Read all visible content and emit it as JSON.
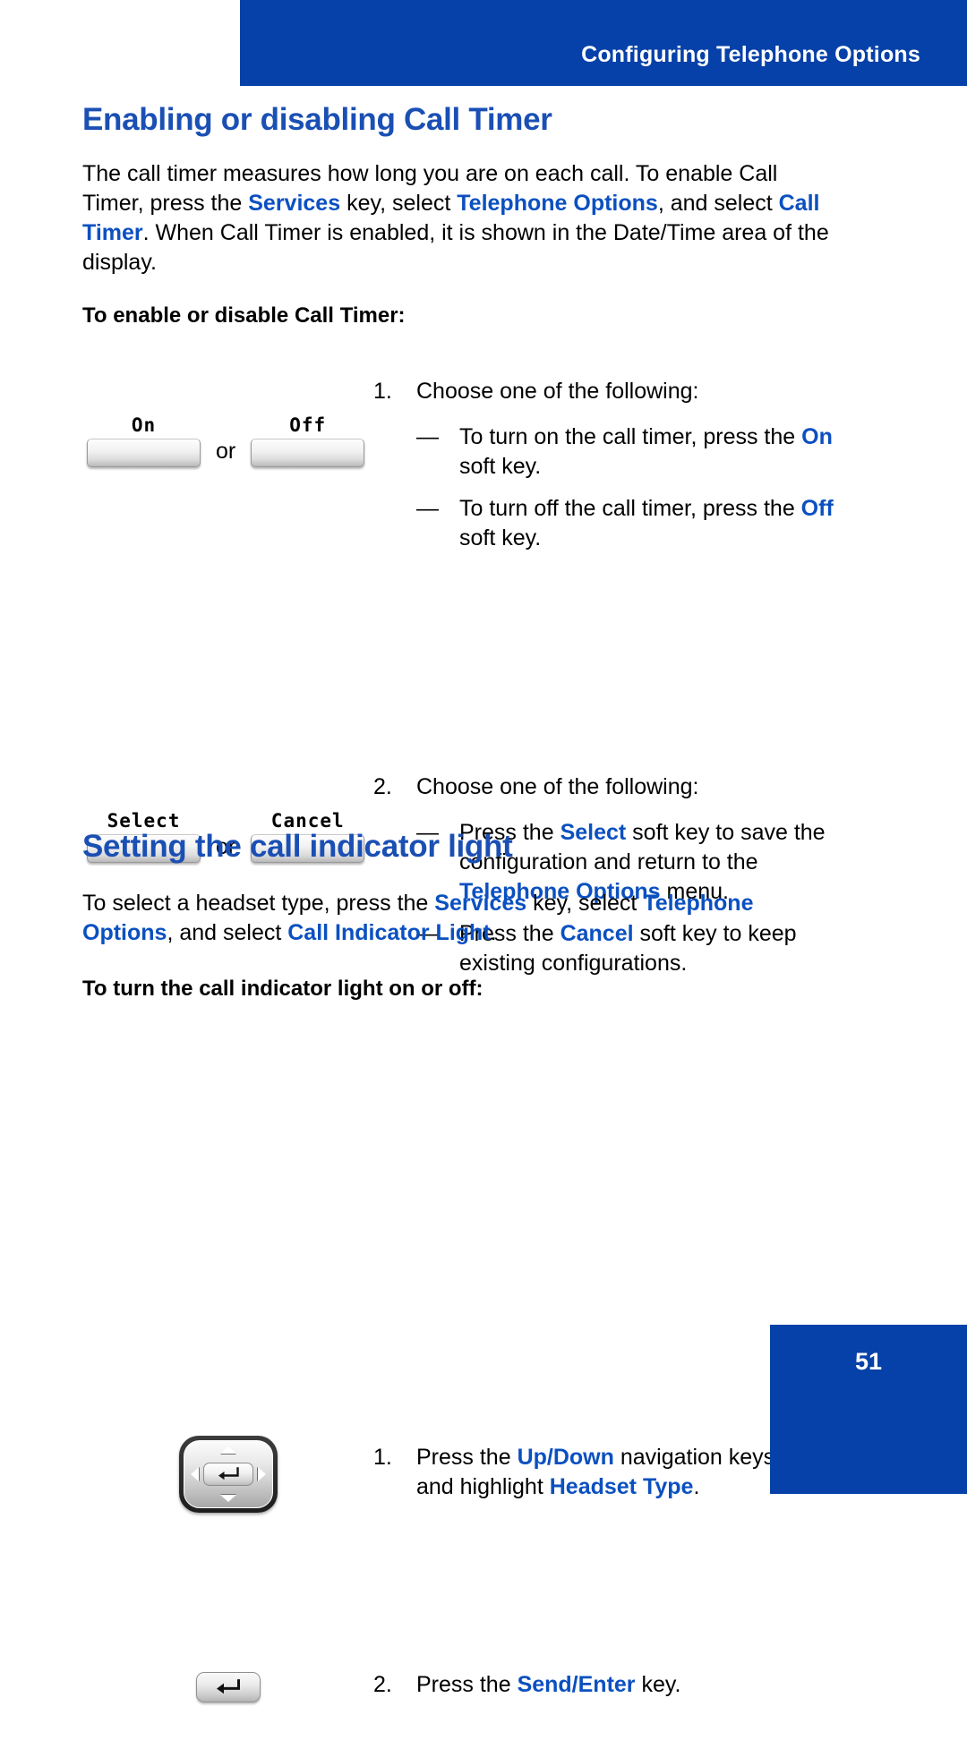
{
  "header": {
    "title": "Configuring Telephone Options",
    "banner_color": "#0541a8"
  },
  "section1": {
    "heading": "Enabling or disabling Call Timer",
    "intro": {
      "p1": "The call timer measures how long you are on each call. To enable Call Timer, press the ",
      "kw1": "Services",
      "p2": " key, select ",
      "kw2": "Telephone Options",
      "p3": ", and select ",
      "kw3": "Call Timer",
      "p4": ". When Call Timer is enabled, it is shown in the Date/Time area of the display."
    },
    "sub_heading": "To enable or disable Call Timer:",
    "step1": {
      "number": "1.",
      "text": "Choose one of the following:",
      "dash": "—",
      "bullets": [
        {
          "pre": "To turn on the call timer, press the ",
          "kw": "On",
          "post": " soft key."
        },
        {
          "pre": "To turn off the call timer, press the ",
          "kw": "Off",
          "post": " soft key."
        }
      ],
      "softkeys": {
        "left": "On",
        "right": "Off",
        "or": "or"
      }
    },
    "step2": {
      "number": "2.",
      "text": "Choose one of the following:",
      "dash": "—",
      "bullets": [
        {
          "pre": "Press the ",
          "kw": "Select",
          "mid": " soft key to save the configuration and return to the ",
          "kw2": "Telephone Options",
          "post": " menu."
        },
        {
          "pre": "Press the ",
          "kw": "Cancel",
          "mid": " soft key to keep existing configurations.",
          "kw2": "",
          "post": ""
        }
      ],
      "softkeys": {
        "left": "Select",
        "right": "Cancel",
        "or": "or"
      }
    }
  },
  "section2": {
    "heading": "Setting the call indicator light",
    "intro": {
      "p1": "To select a headset type, press the ",
      "kw1": "Services",
      "p2": " key, select ",
      "kw2": "Telephone Options",
      "p3": ", and select ",
      "kw3": "Call Indicator Light",
      "p4": "."
    },
    "sub_heading": "To turn the call indicator light on or off:",
    "step1": {
      "number": "1.",
      "pre": "Press the ",
      "kw": "Up/Down",
      "mid": " navigation keys to scroll and highlight ",
      "kw2": "Headset Type",
      "post": "."
    },
    "step2": {
      "number": "2.",
      "pre": "Press the ",
      "kw": "Send/Enter",
      "post": " key."
    }
  },
  "footer": {
    "page_number": "51"
  }
}
